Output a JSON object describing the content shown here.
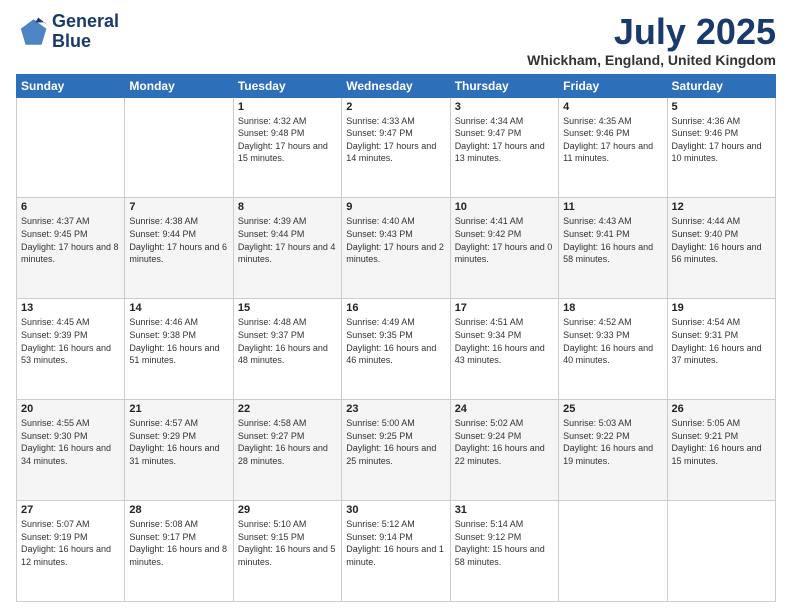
{
  "logo": {
    "line1": "General",
    "line2": "Blue"
  },
  "title": "July 2025",
  "location": "Whickham, England, United Kingdom",
  "days_of_week": [
    "Sunday",
    "Monday",
    "Tuesday",
    "Wednesday",
    "Thursday",
    "Friday",
    "Saturday"
  ],
  "weeks": [
    [
      {
        "day": "",
        "info": ""
      },
      {
        "day": "",
        "info": ""
      },
      {
        "day": "1",
        "info": "Sunrise: 4:32 AM\nSunset: 9:48 PM\nDaylight: 17 hours and 15 minutes."
      },
      {
        "day": "2",
        "info": "Sunrise: 4:33 AM\nSunset: 9:47 PM\nDaylight: 17 hours and 14 minutes."
      },
      {
        "day": "3",
        "info": "Sunrise: 4:34 AM\nSunset: 9:47 PM\nDaylight: 17 hours and 13 minutes."
      },
      {
        "day": "4",
        "info": "Sunrise: 4:35 AM\nSunset: 9:46 PM\nDaylight: 17 hours and 11 minutes."
      },
      {
        "day": "5",
        "info": "Sunrise: 4:36 AM\nSunset: 9:46 PM\nDaylight: 17 hours and 10 minutes."
      }
    ],
    [
      {
        "day": "6",
        "info": "Sunrise: 4:37 AM\nSunset: 9:45 PM\nDaylight: 17 hours and 8 minutes."
      },
      {
        "day": "7",
        "info": "Sunrise: 4:38 AM\nSunset: 9:44 PM\nDaylight: 17 hours and 6 minutes."
      },
      {
        "day": "8",
        "info": "Sunrise: 4:39 AM\nSunset: 9:44 PM\nDaylight: 17 hours and 4 minutes."
      },
      {
        "day": "9",
        "info": "Sunrise: 4:40 AM\nSunset: 9:43 PM\nDaylight: 17 hours and 2 minutes."
      },
      {
        "day": "10",
        "info": "Sunrise: 4:41 AM\nSunset: 9:42 PM\nDaylight: 17 hours and 0 minutes."
      },
      {
        "day": "11",
        "info": "Sunrise: 4:43 AM\nSunset: 9:41 PM\nDaylight: 16 hours and 58 minutes."
      },
      {
        "day": "12",
        "info": "Sunrise: 4:44 AM\nSunset: 9:40 PM\nDaylight: 16 hours and 56 minutes."
      }
    ],
    [
      {
        "day": "13",
        "info": "Sunrise: 4:45 AM\nSunset: 9:39 PM\nDaylight: 16 hours and 53 minutes."
      },
      {
        "day": "14",
        "info": "Sunrise: 4:46 AM\nSunset: 9:38 PM\nDaylight: 16 hours and 51 minutes."
      },
      {
        "day": "15",
        "info": "Sunrise: 4:48 AM\nSunset: 9:37 PM\nDaylight: 16 hours and 48 minutes."
      },
      {
        "day": "16",
        "info": "Sunrise: 4:49 AM\nSunset: 9:35 PM\nDaylight: 16 hours and 46 minutes."
      },
      {
        "day": "17",
        "info": "Sunrise: 4:51 AM\nSunset: 9:34 PM\nDaylight: 16 hours and 43 minutes."
      },
      {
        "day": "18",
        "info": "Sunrise: 4:52 AM\nSunset: 9:33 PM\nDaylight: 16 hours and 40 minutes."
      },
      {
        "day": "19",
        "info": "Sunrise: 4:54 AM\nSunset: 9:31 PM\nDaylight: 16 hours and 37 minutes."
      }
    ],
    [
      {
        "day": "20",
        "info": "Sunrise: 4:55 AM\nSunset: 9:30 PM\nDaylight: 16 hours and 34 minutes."
      },
      {
        "day": "21",
        "info": "Sunrise: 4:57 AM\nSunset: 9:29 PM\nDaylight: 16 hours and 31 minutes."
      },
      {
        "day": "22",
        "info": "Sunrise: 4:58 AM\nSunset: 9:27 PM\nDaylight: 16 hours and 28 minutes."
      },
      {
        "day": "23",
        "info": "Sunrise: 5:00 AM\nSunset: 9:25 PM\nDaylight: 16 hours and 25 minutes."
      },
      {
        "day": "24",
        "info": "Sunrise: 5:02 AM\nSunset: 9:24 PM\nDaylight: 16 hours and 22 minutes."
      },
      {
        "day": "25",
        "info": "Sunrise: 5:03 AM\nSunset: 9:22 PM\nDaylight: 16 hours and 19 minutes."
      },
      {
        "day": "26",
        "info": "Sunrise: 5:05 AM\nSunset: 9:21 PM\nDaylight: 16 hours and 15 minutes."
      }
    ],
    [
      {
        "day": "27",
        "info": "Sunrise: 5:07 AM\nSunset: 9:19 PM\nDaylight: 16 hours and 12 minutes."
      },
      {
        "day": "28",
        "info": "Sunrise: 5:08 AM\nSunset: 9:17 PM\nDaylight: 16 hours and 8 minutes."
      },
      {
        "day": "29",
        "info": "Sunrise: 5:10 AM\nSunset: 9:15 PM\nDaylight: 16 hours and 5 minutes."
      },
      {
        "day": "30",
        "info": "Sunrise: 5:12 AM\nSunset: 9:14 PM\nDaylight: 16 hours and 1 minute."
      },
      {
        "day": "31",
        "info": "Sunrise: 5:14 AM\nSunset: 9:12 PM\nDaylight: 15 hours and 58 minutes."
      },
      {
        "day": "",
        "info": ""
      },
      {
        "day": "",
        "info": ""
      }
    ]
  ]
}
